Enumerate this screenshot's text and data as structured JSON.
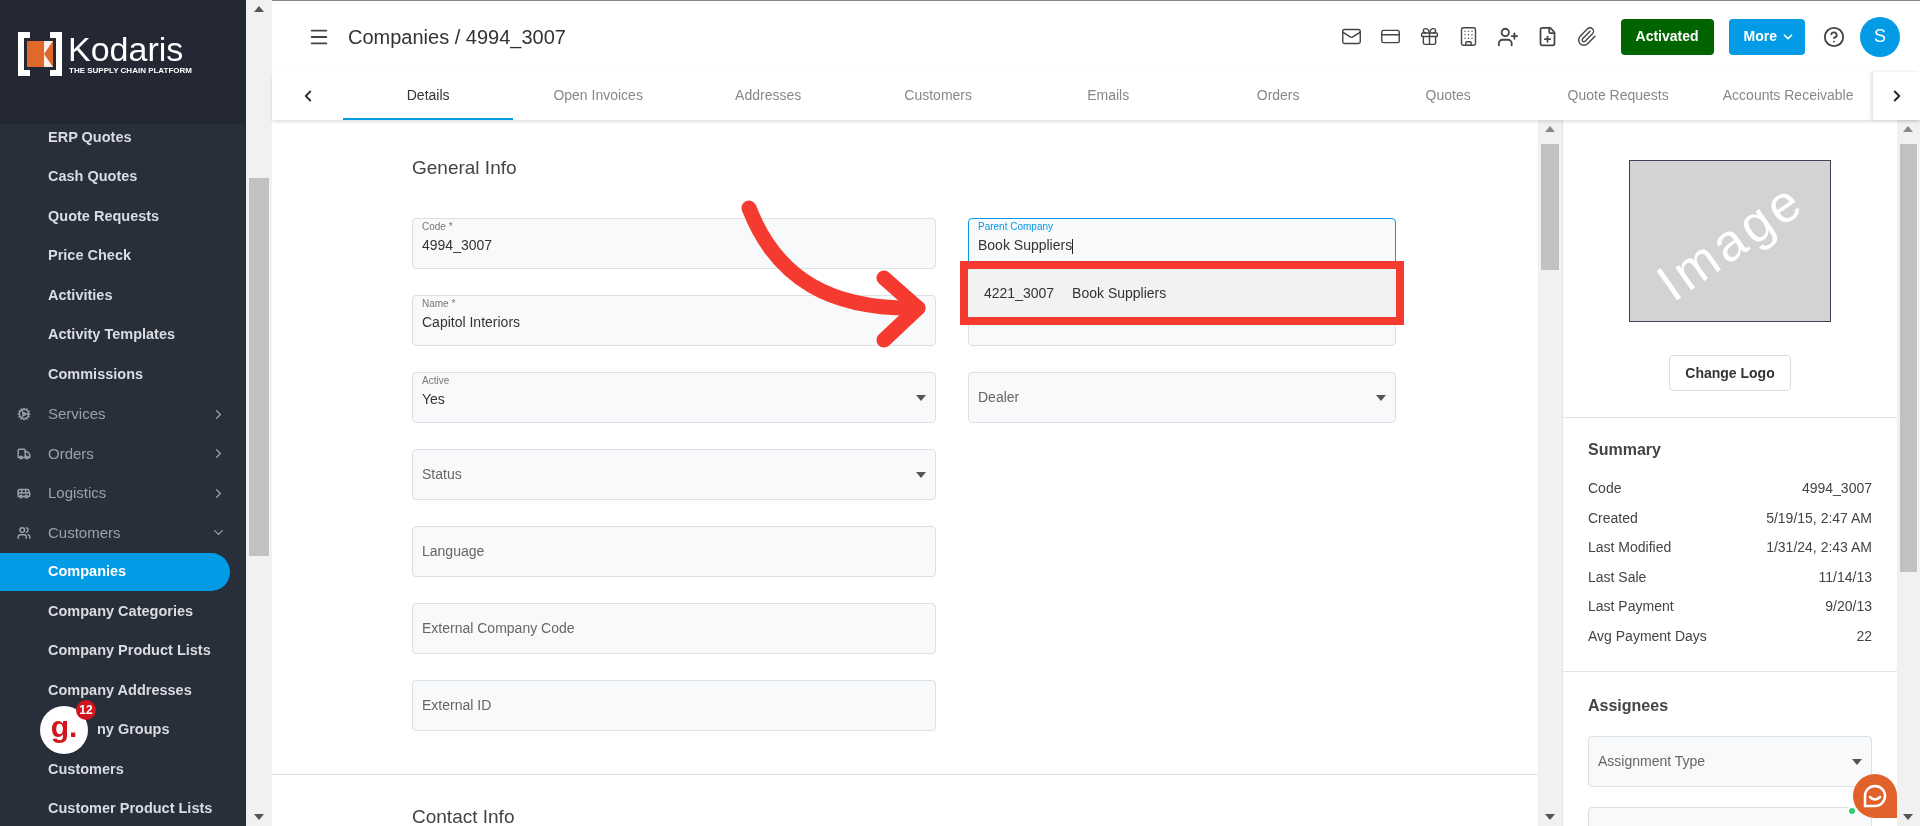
{
  "sidebar": {
    "logo": {
      "name": "Kodaris",
      "tagline": "THE SUPPLY CHAIN PLATFORM"
    },
    "items": [
      {
        "label": "ERP Quotes",
        "kind": "link",
        "selected": false
      },
      {
        "label": "Cash Quotes",
        "kind": "link",
        "selected": false
      },
      {
        "label": "Quote Requests",
        "kind": "link",
        "selected": false
      },
      {
        "label": "Price Check",
        "kind": "link",
        "selected": false
      },
      {
        "label": "Activities",
        "kind": "link",
        "selected": false
      },
      {
        "label": "Activity Templates",
        "kind": "link",
        "selected": false
      },
      {
        "label": "Commissions",
        "kind": "link",
        "selected": false
      },
      {
        "label": "Services",
        "kind": "group",
        "expanded": false
      },
      {
        "label": "Orders",
        "kind": "group",
        "expanded": false
      },
      {
        "label": "Logistics",
        "kind": "group",
        "expanded": false
      },
      {
        "label": "Customers",
        "kind": "group",
        "expanded": true
      },
      {
        "label": "Companies",
        "kind": "link",
        "selected": true
      },
      {
        "label": "Company Categories",
        "kind": "link",
        "selected": false
      },
      {
        "label": "Company Product Lists",
        "kind": "link",
        "selected": false
      },
      {
        "label": "Company Addresses",
        "kind": "link",
        "selected": false
      },
      {
        "label": "ny Groups",
        "kind": "covered_link",
        "selected": false
      },
      {
        "label": "Customers",
        "kind": "link",
        "selected": false
      },
      {
        "label": "Customer Product Lists",
        "kind": "link",
        "selected": false
      }
    ]
  },
  "notification_badge": {
    "letter": "g.",
    "count": "12"
  },
  "header": {
    "title": "Companies / 4994_3007",
    "status_button": "Activated",
    "more_button": "More",
    "avatar": "S"
  },
  "tabs": [
    {
      "label": "Details",
      "selected": true
    },
    {
      "label": "Open Invoices",
      "selected": false
    },
    {
      "label": "Addresses",
      "selected": false
    },
    {
      "label": "Customers",
      "selected": false
    },
    {
      "label": "Emails",
      "selected": false
    },
    {
      "label": "Orders",
      "selected": false
    },
    {
      "label": "Quotes",
      "selected": false
    },
    {
      "label": "Quote Requests",
      "selected": false
    },
    {
      "label": "Accounts Receivable",
      "selected": false
    }
  ],
  "form": {
    "title": "General Info",
    "left_fields": [
      {
        "kind": "text",
        "label": "Code *",
        "value": "4994_3007"
      },
      {
        "kind": "text",
        "label": "Name *",
        "value": "Capitol Interiors"
      },
      {
        "kind": "select",
        "label": "Active",
        "value": "Yes"
      },
      {
        "kind": "select",
        "placeholder": "Status"
      },
      {
        "kind": "text",
        "placeholder": "Language"
      },
      {
        "kind": "text",
        "placeholder": "External Company Code"
      },
      {
        "kind": "text",
        "placeholder": "External ID"
      }
    ],
    "right_fields": [
      {
        "kind": "text",
        "label": "Parent Company",
        "value": "Book Suppliers",
        "focused": true,
        "options": [
          {
            "code": "4221_3007",
            "name": "Book Suppliers",
            "selected": true
          }
        ]
      },
      {
        "kind": "text"
      },
      {
        "kind": "select",
        "placeholder": "Dealer"
      }
    ],
    "next_section": "Contact Info"
  },
  "annotations": {
    "arrow": true,
    "highlight_frame": true
  },
  "side_panel": {
    "image_text": "Image",
    "change_logo": "Change Logo",
    "summary": {
      "title": "Summary",
      "rows": [
        {
          "label": "Code",
          "value": "4994_3007"
        },
        {
          "label": "Created",
          "value": "5/19/15, 2:47 AM"
        },
        {
          "label": "Last Modified",
          "value": "1/31/24, 2:43 AM"
        },
        {
          "label": "Last Sale",
          "value": "11/14/13"
        },
        {
          "label": "Last Payment",
          "value": "9/20/13"
        },
        {
          "label": "Avg Payment Days",
          "value": "22"
        }
      ]
    },
    "assignees": {
      "title": "Assignees",
      "fields": [
        {
          "kind": "select",
          "placeholder": "Assignment Type"
        },
        {
          "kind": "text"
        }
      ]
    }
  }
}
